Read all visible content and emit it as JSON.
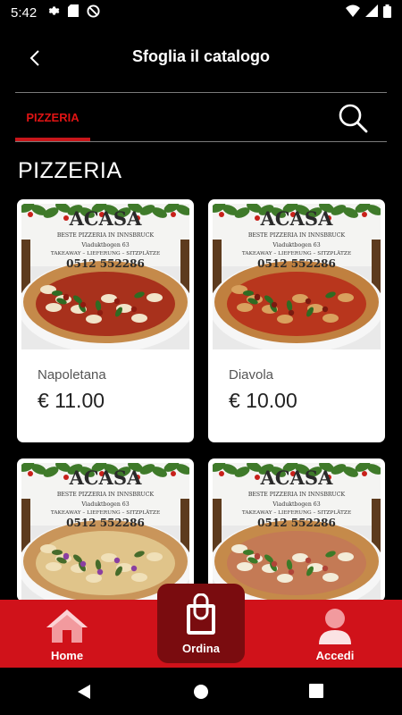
{
  "status_bar": {
    "time": "5:42",
    "left_icons": [
      "gear-icon",
      "sd-card-icon",
      "do-not-disturb-icon"
    ],
    "right_icons": [
      "wifi-icon",
      "signal-icon",
      "battery-icon"
    ]
  },
  "header": {
    "title": "Sfoglia il catalogo",
    "back_icon": "chevron-left-icon"
  },
  "tabs": {
    "active": "PIZZERIA",
    "search_icon": "search-icon"
  },
  "section": {
    "title": "PIZZERIA"
  },
  "products": [
    {
      "name": "Napoletana",
      "price": "€ 11.00"
    },
    {
      "name": "Diavola",
      "price": "€ 10.00"
    },
    {
      "name": "",
      "price": ""
    },
    {
      "name": "",
      "price": ""
    }
  ],
  "photo_sign": {
    "brand": "ACASA",
    "line1": "BESTE PIZZERIA IN INNSBRUCK",
    "line2": "Viaduktbogen 63",
    "line3": "TAKEAWAY – LIEFERUNG – SITZPLÄTZE",
    "phone": "0512 552286"
  },
  "bottom_nav": {
    "home": "Home",
    "ordina": "Ordina",
    "accedi": "Accedi"
  },
  "colors": {
    "accent": "#d0121a",
    "active_nav": "#7a0c0f",
    "tab_active": "#e01414"
  }
}
